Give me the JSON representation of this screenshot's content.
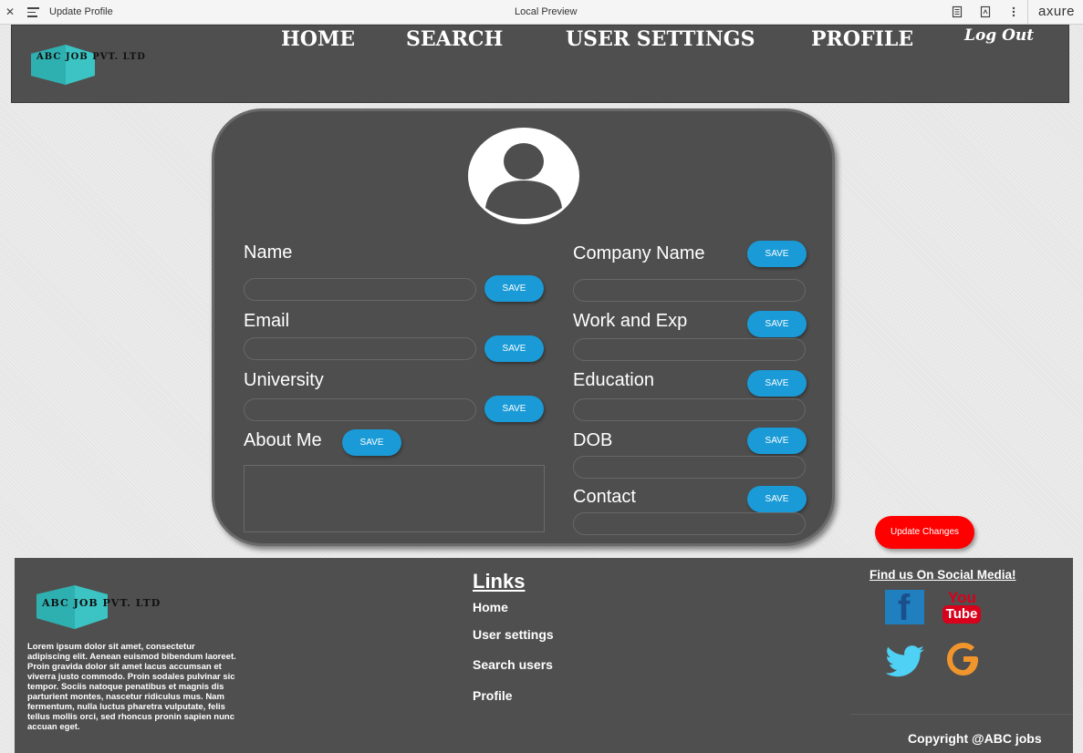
{
  "window": {
    "title": "Update Profile",
    "center_label": "Local Preview",
    "brand": "axure",
    "icons": [
      "close-icon",
      "menu-icon",
      "document-icon",
      "export-icon",
      "more-vertical-icon"
    ]
  },
  "header": {
    "logo_text": "ABC JOB PVT. LTD",
    "nav": {
      "home": "HOME",
      "search": "SEARCH",
      "user_settings": "USER SETTINGS",
      "profile": "PROFILE"
    },
    "logout": "Log Out"
  },
  "form": {
    "avatar_icon": "user-avatar-icon",
    "name_label": "Name",
    "email_label": "Email",
    "university_label": "University",
    "about_label": "About Me",
    "company_label": "Company Name",
    "work_label": "Work and Exp",
    "education_label": "Education",
    "dob_label": "DOB",
    "contact_label": "Contact",
    "save_label": "SAVE",
    "update_label": "Update Changes"
  },
  "footer": {
    "logo_text": "ABC JOB PVT. LTD",
    "about_text": "Lorem ipsum dolor sit amet, consectetur adipiscing elit. Aenean euismod bibendum laoreet. Proin gravida dolor sit amet lacus accumsan et viverra justo commodo. Proin sodales pulvinar sic tempor. Sociis natoque penatibus et magnis dis parturient montes, nascetur ridiculus mus. Nam fermentum, nulla luctus pharetra vulputate, felis tellus mollis orci, sed rhoncus pronin sapien nunc accuan eget.",
    "links_title": "Links",
    "links": {
      "home": "Home",
      "user_settings": "User settings",
      "search_users": "Search users",
      "profile": "Profile"
    },
    "social_title": "Find us On Social Media!",
    "social": {
      "facebook": "f",
      "youtube_top": "You",
      "youtube_bottom": "Tube",
      "google": "G"
    },
    "copyright": "Copyright @ABC jobs"
  },
  "colors": {
    "panel": "#4e4e4e",
    "save_button": "#1a9bd7",
    "update_button": "#ff0000",
    "logo_teal": "#3cc3c3"
  }
}
